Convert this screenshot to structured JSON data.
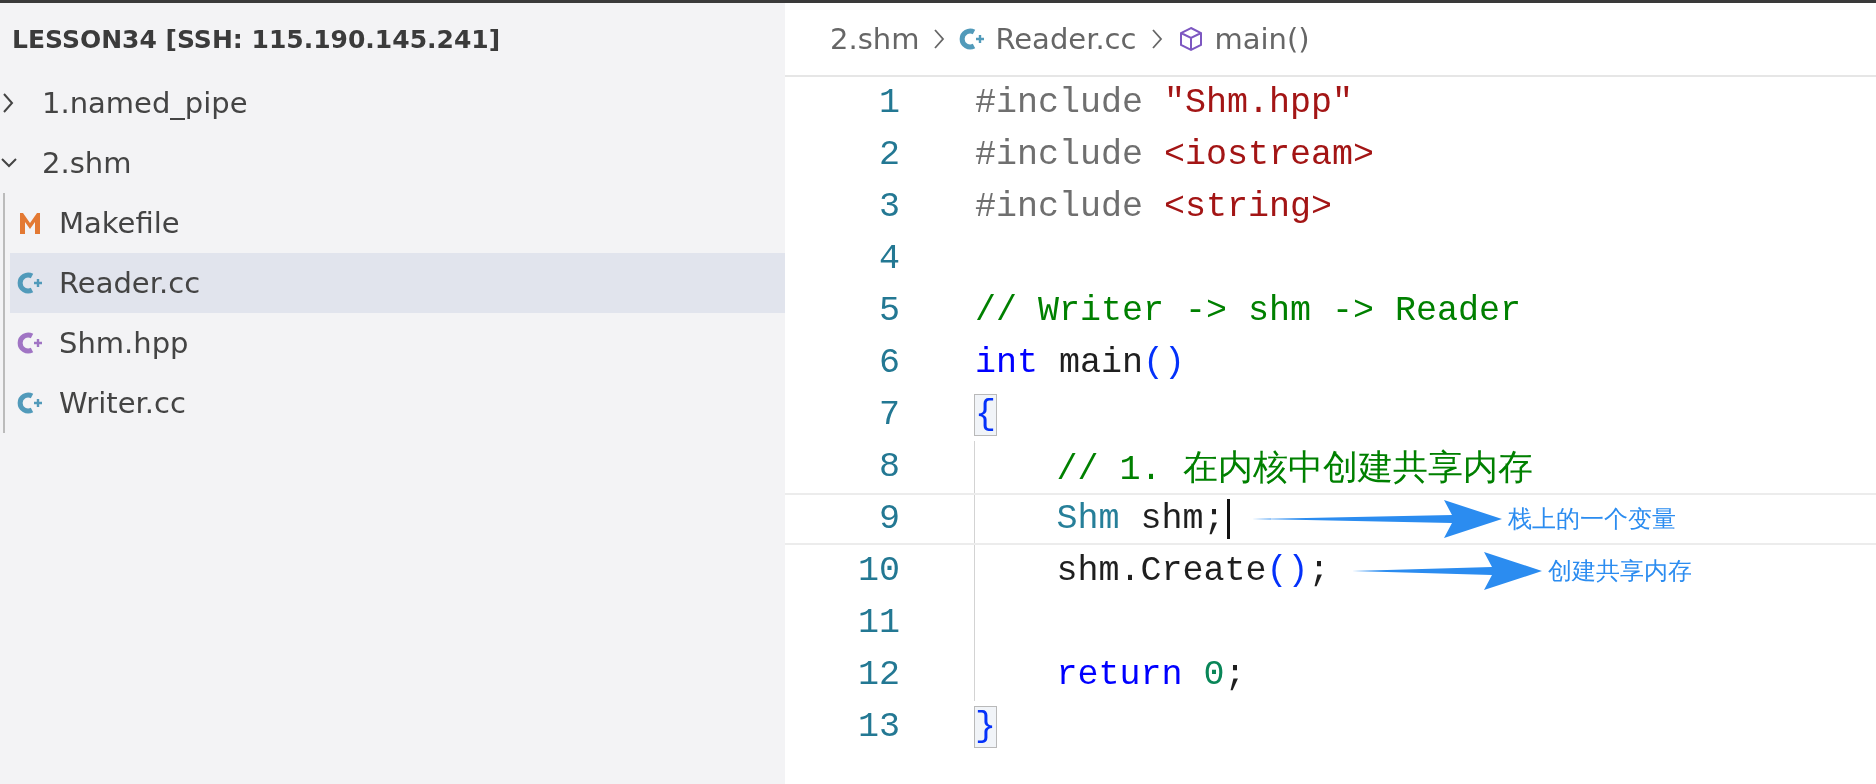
{
  "sidebar": {
    "title": "LESSON34 [SSH: 115.190.145.241]",
    "items": [
      {
        "kind": "folder",
        "label": "1.named_pipe",
        "expanded": false,
        "selected": false
      },
      {
        "kind": "folder",
        "label": "2.shm",
        "expanded": true,
        "selected": false,
        "children": [
          {
            "kind": "makefile",
            "label": "Makefile",
            "selected": false
          },
          {
            "kind": "cpp",
            "label": "Reader.cc",
            "selected": true
          },
          {
            "kind": "header",
            "label": "Shm.hpp",
            "selected": false
          },
          {
            "kind": "cpp",
            "label": "Writer.cc",
            "selected": false
          }
        ]
      }
    ]
  },
  "breadcrumbs": [
    {
      "kind": "folder",
      "label": "2.shm"
    },
    {
      "kind": "cpp",
      "label": "Reader.cc"
    },
    {
      "kind": "symbol",
      "label": "main()"
    }
  ],
  "editor": {
    "lines": [
      {
        "number": "1",
        "tokens": [
          {
            "kind": "preproc",
            "text": "#include"
          },
          {
            "kind": "string",
            "text": " \"Shm.hpp\""
          }
        ]
      },
      {
        "number": "2",
        "tokens": [
          {
            "kind": "preproc",
            "text": "#include"
          },
          {
            "kind": "string",
            "text": " <iostream>"
          }
        ]
      },
      {
        "number": "3",
        "tokens": [
          {
            "kind": "preproc",
            "text": "#include"
          },
          {
            "kind": "string",
            "text": " <string>"
          }
        ]
      },
      {
        "number": "4"
      },
      {
        "number": "5",
        "tokens": [
          {
            "kind": "comment",
            "text": "// Writer -> shm -> Reader"
          }
        ]
      },
      {
        "number": "6",
        "tokens": [
          {
            "kind": "keyword",
            "text": "int"
          },
          {
            "kind": "plain",
            "text": " main"
          },
          {
            "kind": "bracket",
            "text": "()"
          }
        ]
      },
      {
        "number": "7",
        "tokens": [
          {
            "kind": "brace",
            "text": "{"
          }
        ]
      },
      {
        "number": "8",
        "indented": true,
        "tokens": [
          {
            "kind": "comment",
            "text": "// 1. 在内核中创建共享内存"
          }
        ]
      },
      {
        "number": "9",
        "indented": true,
        "current": true,
        "cursor": true,
        "annotation": "栈上的一个变量",
        "tokens": [
          {
            "kind": "type",
            "text": "Shm"
          },
          {
            "kind": "plain",
            "text": " shm;"
          }
        ]
      },
      {
        "number": "10",
        "indented": true,
        "annotation": "创建共享内存",
        "tokens": [
          {
            "kind": "plain",
            "text": "shm.Create"
          },
          {
            "kind": "bracket",
            "text": "()"
          },
          {
            "kind": "plain",
            "text": ";"
          }
        ]
      },
      {
        "number": "11",
        "indented": true
      },
      {
        "number": "12",
        "indented": true,
        "tokens": [
          {
            "kind": "keyword",
            "text": "return"
          },
          {
            "kind": "number",
            "text": " 0"
          },
          {
            "kind": "plain",
            "text": ";"
          }
        ]
      },
      {
        "number": "13",
        "tokens": [
          {
            "kind": "brace",
            "text": "}"
          }
        ]
      }
    ]
  }
}
